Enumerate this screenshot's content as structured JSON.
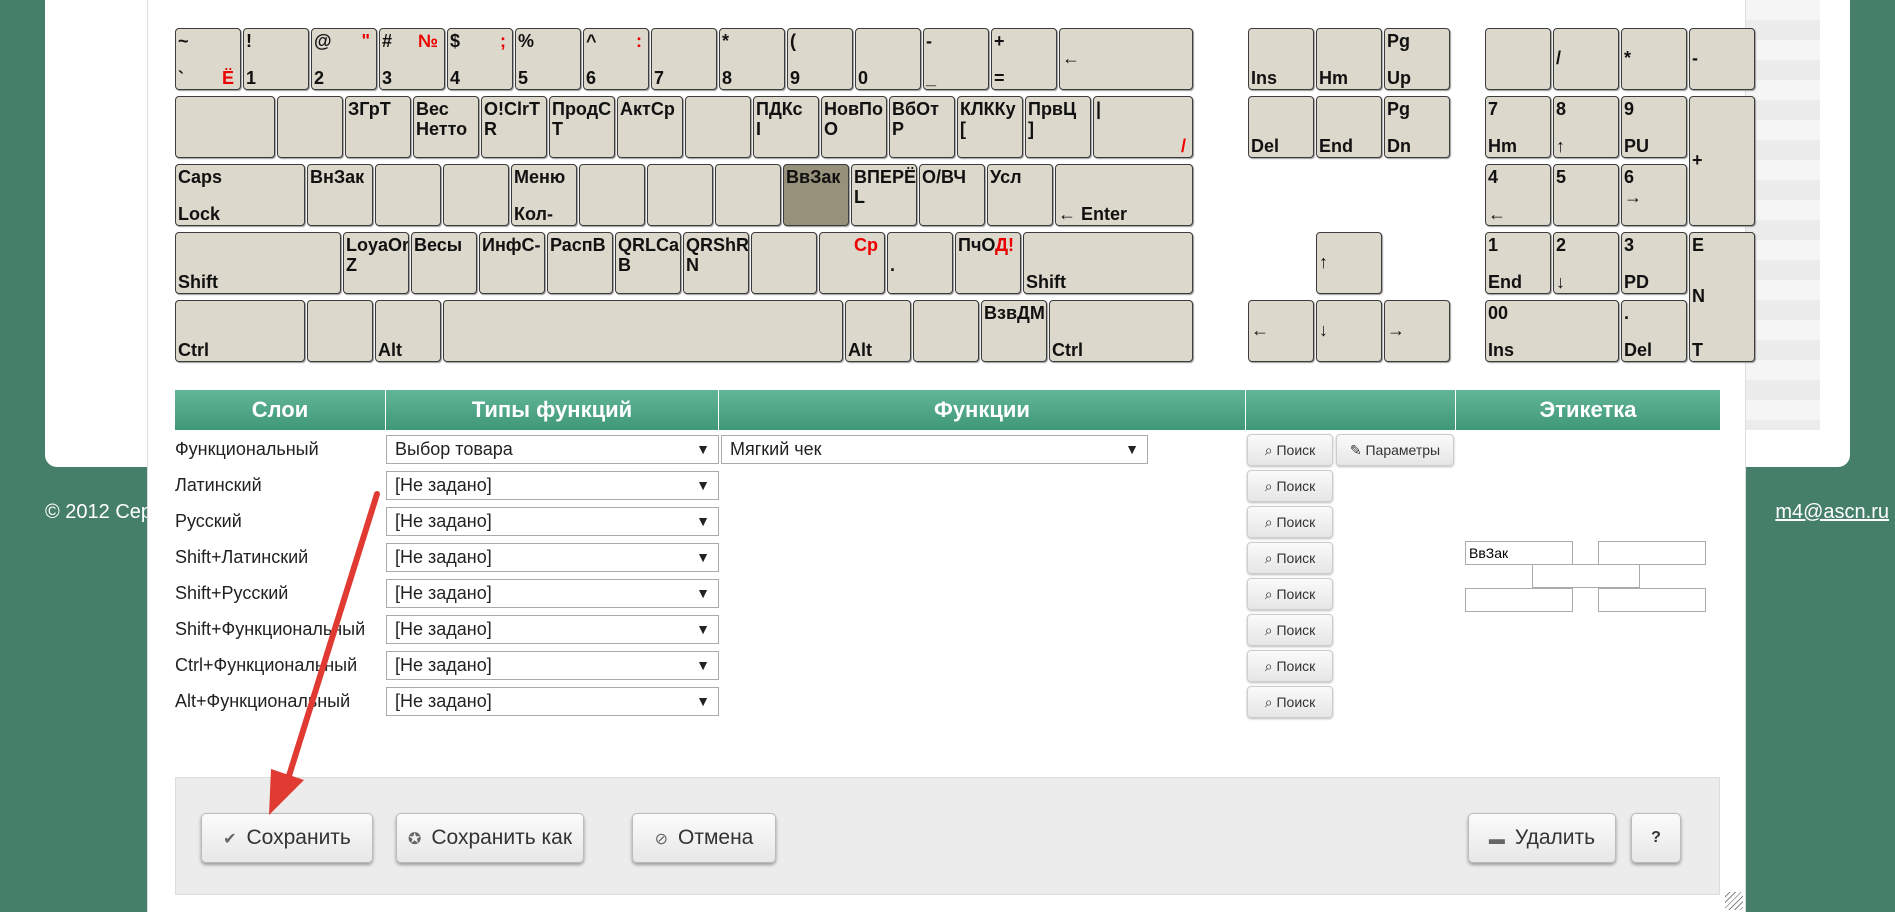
{
  "footer": {
    "left": "© 2012 Сер",
    "right": "m4@ascn.ru"
  },
  "keys": [
    {
      "n": "key-tilde",
      "l": 0,
      "t": 28,
      "w": 66,
      "tl": "~",
      "bl": "`",
      "rt": "",
      "rb": "Ё"
    },
    {
      "n": "key-1",
      "l": 68,
      "t": 28,
      "w": 66,
      "tl": "!",
      "bl": "1",
      "rt": "",
      "rb": ""
    },
    {
      "n": "key-2",
      "l": 136,
      "t": 28,
      "w": 66,
      "tl": "@",
      "bl": "2",
      "rt": "\"",
      "rb": ""
    },
    {
      "n": "key-3",
      "l": 204,
      "t": 28,
      "w": 66,
      "tl": "#",
      "bl": "3",
      "rt": "№",
      "rb": ""
    },
    {
      "n": "key-4",
      "l": 272,
      "t": 28,
      "w": 66,
      "tl": "$",
      "bl": "4",
      "rt": ";",
      "rb": ""
    },
    {
      "n": "key-5",
      "l": 340,
      "t": 28,
      "w": 66,
      "tl": "%",
      "bl": "5",
      "rt": "",
      "rb": ""
    },
    {
      "n": "key-6",
      "l": 408,
      "t": 28,
      "w": 66,
      "tl": "^",
      "bl": "6",
      "rt": ":",
      "rb": ""
    },
    {
      "n": "key-7",
      "l": 476,
      "t": 28,
      "w": 66,
      "tl": "",
      "bl": "7",
      "rt": "",
      "rb": ""
    },
    {
      "n": "key-8",
      "l": 544,
      "t": 28,
      "w": 66,
      "tl": "*",
      "bl": "8",
      "rt": "",
      "rb": ""
    },
    {
      "n": "key-9",
      "l": 612,
      "t": 28,
      "w": 66,
      "tl": "(",
      "bl": "9",
      "rt": "",
      "rb": ""
    },
    {
      "n": "key-0",
      "l": 680,
      "t": 28,
      "w": 66,
      "tl": "",
      "bl": "0",
      "rt": "",
      "rb": ""
    },
    {
      "n": "key-minus",
      "l": 748,
      "t": 28,
      "w": 66,
      "tl": "-",
      "bl": "_",
      "rt": "",
      "rb": ""
    },
    {
      "n": "key-plus",
      "l": 816,
      "t": 28,
      "w": 66,
      "tl": "+",
      "bl": "=",
      "rt": "",
      "rb": ""
    },
    {
      "n": "key-backspace",
      "l": 884,
      "t": 28,
      "w": 134,
      "ml": "←"
    },
    {
      "n": "key-tab",
      "l": 0,
      "t": 96,
      "w": 100
    },
    {
      "n": "key-q",
      "l": 102,
      "t": 96,
      "w": 66
    },
    {
      "n": "key-w",
      "l": 170,
      "t": 96,
      "w": 66,
      "tl": "ЗГрТ"
    },
    {
      "n": "key-e",
      "l": 238,
      "t": 96,
      "w": 66,
      "tl": "Вес",
      "t2": "Нетто"
    },
    {
      "n": "key-r",
      "l": 306,
      "t": 96,
      "w": 66,
      "tl": "О!ClrT",
      "t2": "R"
    },
    {
      "n": "key-t",
      "l": 374,
      "t": 96,
      "w": 66,
      "tl": "ПродС",
      "t2": "T"
    },
    {
      "n": "key-y",
      "l": 442,
      "t": 96,
      "w": 66,
      "tl": "АктСр"
    },
    {
      "n": "key-u",
      "l": 510,
      "t": 96,
      "w": 66
    },
    {
      "n": "key-i",
      "l": 578,
      "t": 96,
      "w": 66,
      "tl": "ПДКс",
      "t2": "I"
    },
    {
      "n": "key-o",
      "l": 646,
      "t": 96,
      "w": 66,
      "tl": "НовПо",
      "t2": "O"
    },
    {
      "n": "key-p",
      "l": 714,
      "t": 96,
      "w": 66,
      "tl": "ВбОт",
      "t2": "P"
    },
    {
      "n": "key-lbracket",
      "l": 782,
      "t": 96,
      "w": 66,
      "tl": "КЛККу",
      "t2": "["
    },
    {
      "n": "key-rbracket",
      "l": 850,
      "t": 96,
      "w": 66,
      "tl": "ПрвЦ",
      "t2": "]"
    },
    {
      "n": "key-backslash",
      "l": 918,
      "t": 96,
      "w": 100,
      "tl": "|",
      "rb": "/"
    },
    {
      "n": "key-caps",
      "l": 0,
      "t": 164,
      "w": 130,
      "tl": "Caps",
      "bl": "Lock"
    },
    {
      "n": "key-a",
      "l": 132,
      "t": 164,
      "w": 66,
      "tl": "ВнЗак"
    },
    {
      "n": "key-s",
      "l": 200,
      "t": 164,
      "w": 66
    },
    {
      "n": "key-d",
      "l": 268,
      "t": 164,
      "w": 66
    },
    {
      "n": "key-f",
      "l": 336,
      "t": 164,
      "w": 66,
      "tl": "Меню",
      "bl": "Кол-"
    },
    {
      "n": "key-g",
      "l": 404,
      "t": 164,
      "w": 66
    },
    {
      "n": "key-h",
      "l": 472,
      "t": 164,
      "w": 66
    },
    {
      "n": "key-j",
      "l": 540,
      "t": 164,
      "w": 66
    },
    {
      "n": "key-k",
      "l": 608,
      "t": 164,
      "w": 66,
      "tl": "ВвЗак",
      "sel": true
    },
    {
      "n": "key-l",
      "l": 676,
      "t": 164,
      "w": 66,
      "tl": "ВПЕРЁ",
      "t2": "L"
    },
    {
      "n": "key-semicolon",
      "l": 744,
      "t": 164,
      "w": 66,
      "tl": "О/ВЧ"
    },
    {
      "n": "key-quote",
      "l": 812,
      "t": 164,
      "w": 66,
      "tl": "Усл"
    },
    {
      "n": "key-enter",
      "l": 880,
      "t": 164,
      "w": 138,
      "bl": "← Enter"
    },
    {
      "n": "key-lshift",
      "l": 0,
      "t": 232,
      "w": 166,
      "bl": "Shift"
    },
    {
      "n": "key-z",
      "l": 168,
      "t": 232,
      "w": 66,
      "tl": "LoyaOr",
      "t2": "Z"
    },
    {
      "n": "key-x",
      "l": 236,
      "t": 232,
      "w": 66,
      "tl": "Весы"
    },
    {
      "n": "key-c",
      "l": 304,
      "t": 232,
      "w": 66,
      "tl": "ИнфС-"
    },
    {
      "n": "key-v",
      "l": 372,
      "t": 232,
      "w": 66,
      "tl": "РаспВ"
    },
    {
      "n": "key-b",
      "l": 440,
      "t": 232,
      "w": 66,
      "tl": "QRLCa",
      "t2": "B"
    },
    {
      "n": "key-n",
      "l": 508,
      "t": 232,
      "w": 66,
      "tl": "QRShR",
      "t2": "N"
    },
    {
      "n": "key-m",
      "l": 576,
      "t": 232,
      "w": 66
    },
    {
      "n": "key-comma",
      "l": 644,
      "t": 232,
      "w": 66,
      "rt": "Ср"
    },
    {
      "n": "key-period",
      "l": 712,
      "t": 232,
      "w": 66,
      "t2": "."
    },
    {
      "n": "key-slash",
      "l": 780,
      "t": 232,
      "w": 66,
      "tl": "ПчОД",
      "rt": "Д!"
    },
    {
      "n": "key-rshift",
      "l": 848,
      "t": 232,
      "w": 170,
      "bl": "Shift"
    },
    {
      "n": "key-lctrl",
      "l": 0,
      "t": 300,
      "w": 130,
      "bl": "Ctrl"
    },
    {
      "n": "key-win",
      "l": 132,
      "t": 300,
      "w": 66
    },
    {
      "n": "key-lalt",
      "l": 200,
      "t": 300,
      "w": 66,
      "bl": "Alt"
    },
    {
      "n": "key-space",
      "l": 268,
      "t": 300,
      "w": 400
    },
    {
      "n": "key-ralt",
      "l": 670,
      "t": 300,
      "w": 66,
      "bl": "Alt"
    },
    {
      "n": "key-rwin",
      "l": 738,
      "t": 300,
      "w": 66
    },
    {
      "n": "key-menu",
      "l": 806,
      "t": 300,
      "w": 66,
      "tl": "ВзвДМ"
    },
    {
      "n": "key-rctrl",
      "l": 874,
      "t": 300,
      "w": 144,
      "bl": "Ctrl"
    },
    {
      "n": "key-ins",
      "l": 1073,
      "t": 28,
      "w": 66,
      "bl": "Ins"
    },
    {
      "n": "key-home",
      "l": 1141,
      "t": 28,
      "w": 66,
      "bl": "Hm"
    },
    {
      "n": "key-pgup",
      "l": 1209,
      "t": 28,
      "w": 66,
      "tl": "Pg",
      "bl": "Up"
    },
    {
      "n": "key-del",
      "l": 1073,
      "t": 96,
      "w": 66,
      "bl": "Del"
    },
    {
      "n": "key-end",
      "l": 1141,
      "t": 96,
      "w": 66,
      "bl": "End"
    },
    {
      "n": "key-pgdn",
      "l": 1209,
      "t": 96,
      "w": 66,
      "tl": "Pg",
      "bl": "Dn"
    },
    {
      "n": "key-up",
      "l": 1141,
      "t": 232,
      "w": 66,
      "ml": "↑"
    },
    {
      "n": "key-left",
      "l": 1073,
      "t": 300,
      "w": 66,
      "ml": "←"
    },
    {
      "n": "key-down",
      "l": 1141,
      "t": 300,
      "w": 66,
      "ml": "↓"
    },
    {
      "n": "key-right",
      "l": 1209,
      "t": 300,
      "w": 66,
      "ml": "→"
    },
    {
      "n": "key-numlock",
      "l": 1310,
      "t": 28,
      "w": 66
    },
    {
      "n": "key-numdiv",
      "l": 1378,
      "t": 28,
      "w": 66,
      "ml": "/"
    },
    {
      "n": "key-nummul",
      "l": 1446,
      "t": 28,
      "w": 66,
      "ml": "*"
    },
    {
      "n": "key-numsub",
      "l": 1514,
      "t": 28,
      "w": 66,
      "ml": "-"
    },
    {
      "n": "key-num7",
      "l": 1310,
      "t": 96,
      "w": 66,
      "tl": "7",
      "bl": "Hm"
    },
    {
      "n": "key-num8",
      "l": 1378,
      "t": 96,
      "w": 66,
      "tl": "8",
      "bl": "↑"
    },
    {
      "n": "key-num9",
      "l": 1446,
      "t": 96,
      "w": 66,
      "tl": "9",
      "bl": "PU"
    },
    {
      "n": "key-numadd",
      "l": 1514,
      "t": 96,
      "w": 66,
      "h": 130,
      "ml": "+"
    },
    {
      "n": "key-num4",
      "l": 1310,
      "t": 164,
      "w": 66,
      "tl": "4",
      "bl": "←"
    },
    {
      "n": "key-num5",
      "l": 1378,
      "t": 164,
      "w": 66,
      "tl": "5"
    },
    {
      "n": "key-num6",
      "l": 1446,
      "t": 164,
      "w": 66,
      "tl": "6",
      "t2": "→"
    },
    {
      "n": "key-num1",
      "l": 1310,
      "t": 232,
      "w": 66,
      "tl": "1",
      "bl": "End"
    },
    {
      "n": "key-num2",
      "l": 1378,
      "t": 232,
      "w": 66,
      "tl": "2",
      "bl": "↓"
    },
    {
      "n": "key-num3",
      "l": 1446,
      "t": 232,
      "w": 66,
      "tl": "3",
      "bl": "PD"
    },
    {
      "n": "key-numenter",
      "l": 1514,
      "t": 232,
      "w": 66,
      "h": 130,
      "tl": "E",
      "ml": "N",
      "bl": "T"
    },
    {
      "n": "key-num0",
      "l": 1310,
      "t": 300,
      "w": 134,
      "tl": "00",
      "bl": "Ins"
    },
    {
      "n": "key-numdot",
      "l": 1446,
      "t": 300,
      "w": 66,
      "tl": ".",
      "bl": "Del"
    }
  ],
  "table": {
    "headers": [
      "Слои",
      "Типы функций",
      "Функции",
      "",
      "Этикетка"
    ],
    "rows": [
      {
        "layer": "Функциональный",
        "type": "Выбор товара",
        "func": "Мягкий чек",
        "params": true
      },
      {
        "layer": "Латинский",
        "type": "[Не задано]"
      },
      {
        "layer": "Русский",
        "type": "[Не задано]"
      },
      {
        "layer": "Shift+Латинский",
        "type": "[Не задано]"
      },
      {
        "layer": "Shift+Русский",
        "type": "[Не задано]"
      },
      {
        "layer": "Shift+Функциональный",
        "type": "[Не задано]"
      },
      {
        "layer": "Ctrl+Функциональный",
        "type": "[Не задано]"
      },
      {
        "layer": "Alt+Функциональный",
        "type": "[Не задано]"
      }
    ],
    "search_label": "Поиск",
    "params_label": "Параметры",
    "label_inputs": [
      "ВвЗак",
      "",
      "",
      "",
      ""
    ]
  },
  "buttons": {
    "save": "Сохранить",
    "save_as": "Сохранить как",
    "cancel": "Отмена",
    "delete": "Удалить",
    "help": "?"
  },
  "colors": {
    "header_green": "#4fa886",
    "selected_key": "#97907a",
    "annotation_arrow": "#e03a32"
  }
}
